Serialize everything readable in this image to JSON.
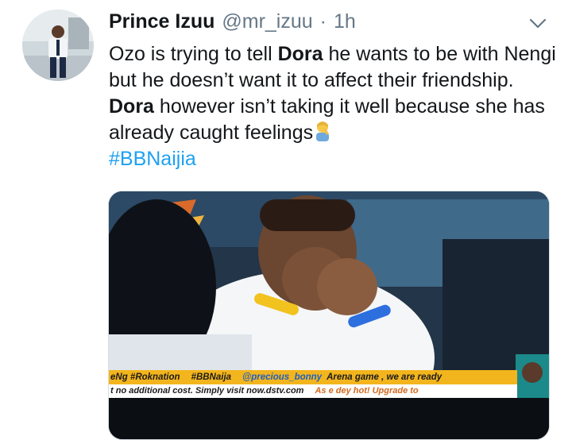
{
  "author": {
    "display_name": "Prince Izuu",
    "handle": "@mr_izuu",
    "separator": "·",
    "time": "1h"
  },
  "tweet": {
    "text_1": "Ozo is trying to tell ",
    "bold_1": "Dora",
    "text_2": " he wants to be with Nengi but he doesn’t want it to affect their friendship. ",
    "bold_2": "Dora",
    "text_3": " however isn’t taking it well because she has already caught feelings",
    "hashtag": "#BBNaijia"
  },
  "media": {
    "ticker_line_1": {
      "a": "eNg #Roknation",
      "b": "#BBNaija",
      "c": "@precious_bonny",
      "d": "Arena game , we are ready"
    },
    "ticker_line_2": {
      "a": "t no additional cost. Simply visit now.dstv.com",
      "b": "As e dey hot! Upgrade to"
    }
  },
  "icons": {
    "menu": "chevron-down-icon",
    "emoji": "person-facepalming-emoji"
  },
  "colors": {
    "name": "#14171a",
    "muted": "#657786",
    "link": "#1da1f2",
    "ticker": "#f3b51d"
  }
}
